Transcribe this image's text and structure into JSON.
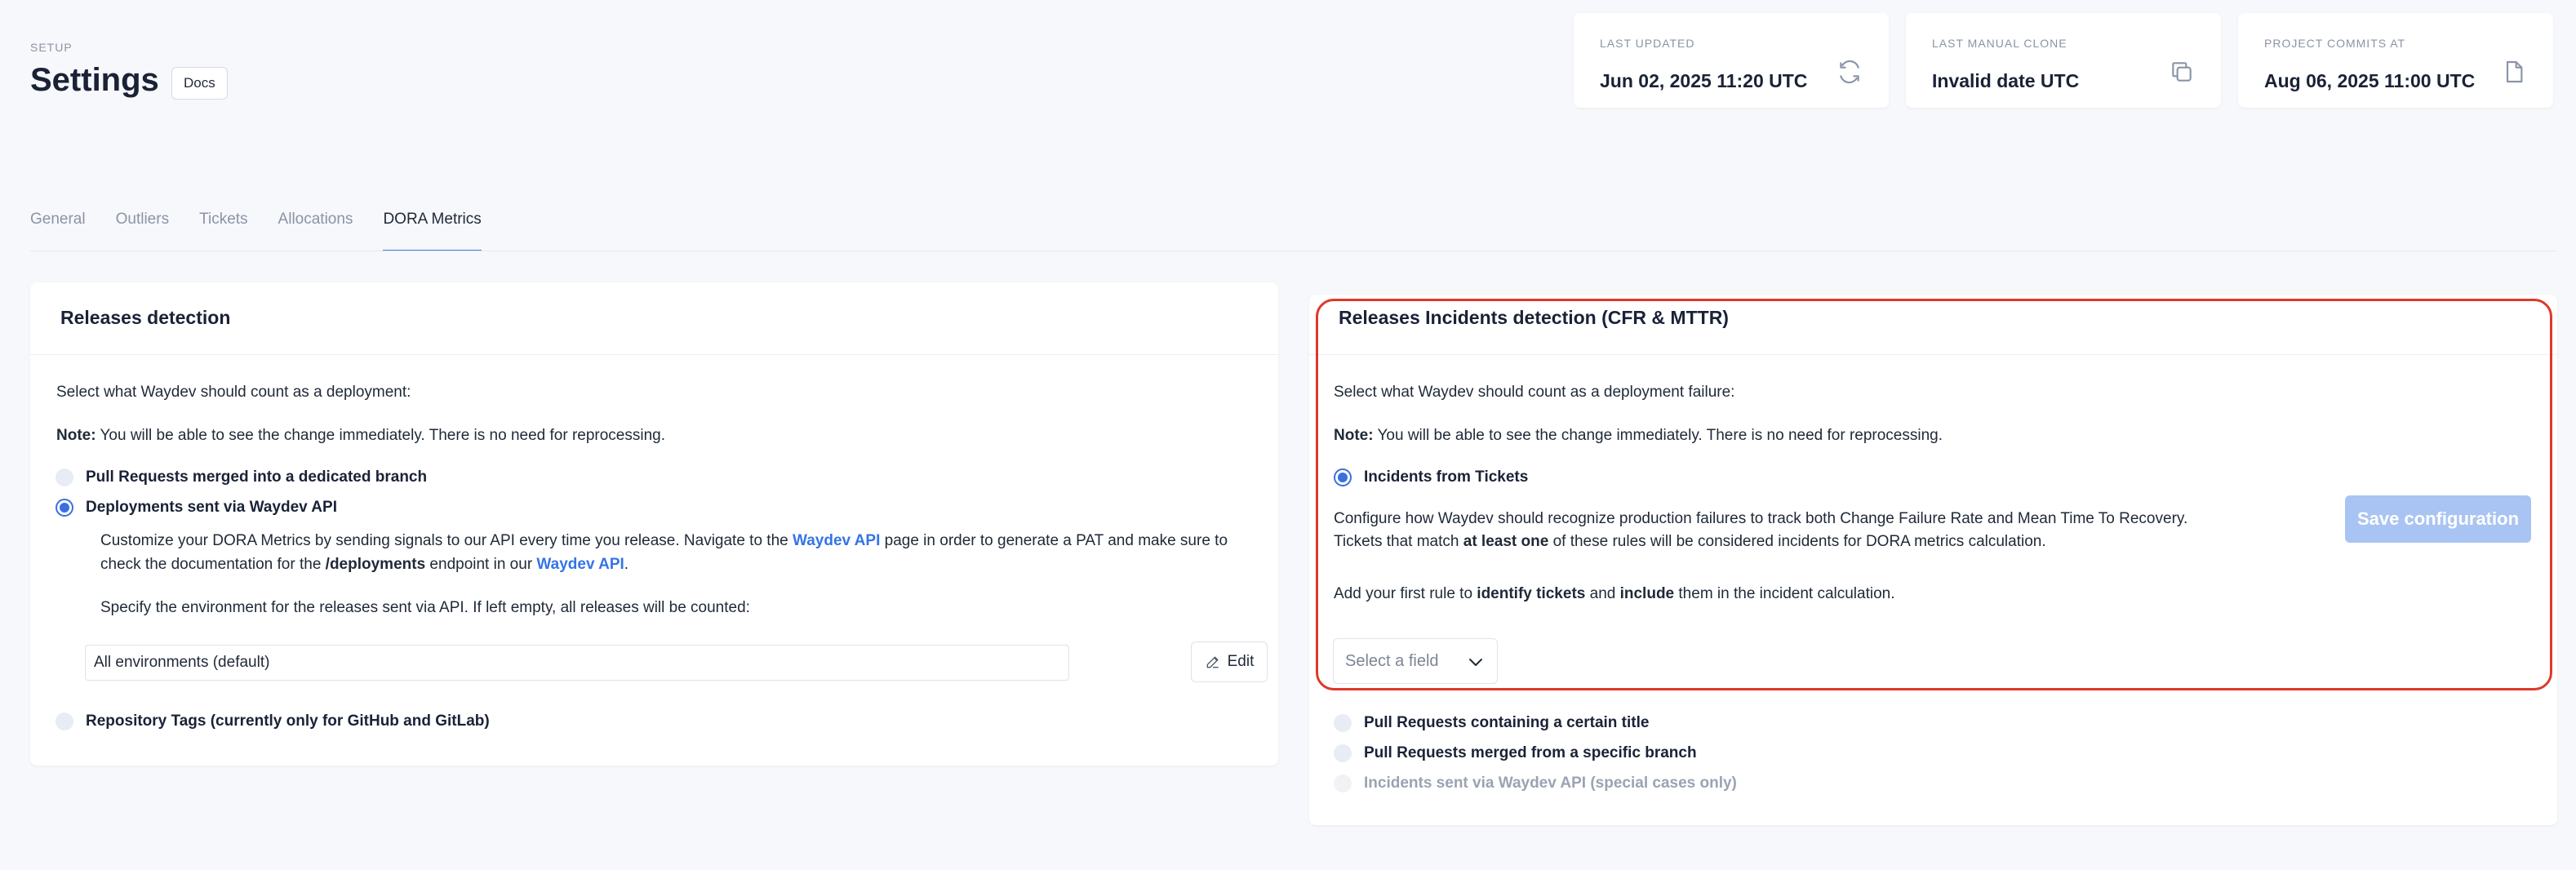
{
  "header": {
    "section": "SETUP",
    "title": "Settings",
    "docs_label": "Docs"
  },
  "stats": [
    {
      "label": "LAST UPDATED",
      "value": "Jun 02, 2025 11:20 UTC",
      "icon": "refresh-icon"
    },
    {
      "label": "LAST MANUAL CLONE",
      "value": "Invalid date UTC",
      "icon": "copy-icon"
    },
    {
      "label": "PROJECT COMMITS AT",
      "value": "Aug 06, 2025 11:00 UTC",
      "icon": "file-icon"
    }
  ],
  "tabs": [
    {
      "label": "General"
    },
    {
      "label": "Outliers"
    },
    {
      "label": "Tickets"
    },
    {
      "label": "Allocations"
    },
    {
      "label": "DORA Metrics",
      "active": true
    }
  ],
  "releases": {
    "title": "Releases detection",
    "intro": "Select what Waydev should count as a deployment:",
    "note_label": "Note:",
    "note_text": " You will be able to see the change immediately. There is no need for reprocessing.",
    "options": [
      {
        "label": "Pull Requests merged into a dedicated branch",
        "checked": false
      },
      {
        "label": "Deployments sent via Waydev API",
        "checked": true
      },
      {
        "label": "Repository Tags (currently only for GitHub and GitLab)",
        "checked": false
      }
    ],
    "desc_1a": "Customize your DORA Metrics by sending signals to our API every time you release. Navigate to the ",
    "desc_link_1": "Waydev API",
    "desc_1b": " page in order to generate a PAT and make sure to",
    "desc_2a": "check the documentation for the ",
    "desc_2_bold": "/deployments",
    "desc_2b": " endpoint in our ",
    "desc_link_2": "Waydev API",
    "desc_2c": ".",
    "env_prompt": "Specify the environment for the releases sent via API. If left empty, all releases will be counted:",
    "env_value": "All environments (default)",
    "edit_label": "Edit"
  },
  "incidents": {
    "title": "Releases Incidents detection (CFR & MTTR)",
    "intro": "Select what Waydev should count as a deployment failure:",
    "note_label": "Note:",
    "note_text": " You will be able to see the change immediately. There is no need for reprocessing.",
    "selected_option": "Incidents from Tickets",
    "desc_1": "Configure how Waydev should recognize production failures to track both Change Failure Rate and Mean Time To Recovery.",
    "desc_2a": "Tickets that match ",
    "desc_2_bold": "at least one",
    "desc_2b": " of these rules will be considered incidents for DORA metrics calculation.",
    "rule_a": "Add your first rule to ",
    "rule_bold_1": "identify tickets",
    "rule_b": " and ",
    "rule_bold_2": "include",
    "rule_c": " them in the incident calculation.",
    "select_placeholder": "Select a field",
    "save_label": "Save configuration",
    "other_options": [
      {
        "label": "Pull Requests containing a certain title",
        "disabled": false
      },
      {
        "label": "Pull Requests merged from a specific branch",
        "disabled": false
      },
      {
        "label": "Incidents sent via Waydev API (special cases only)",
        "disabled": true
      }
    ]
  }
}
